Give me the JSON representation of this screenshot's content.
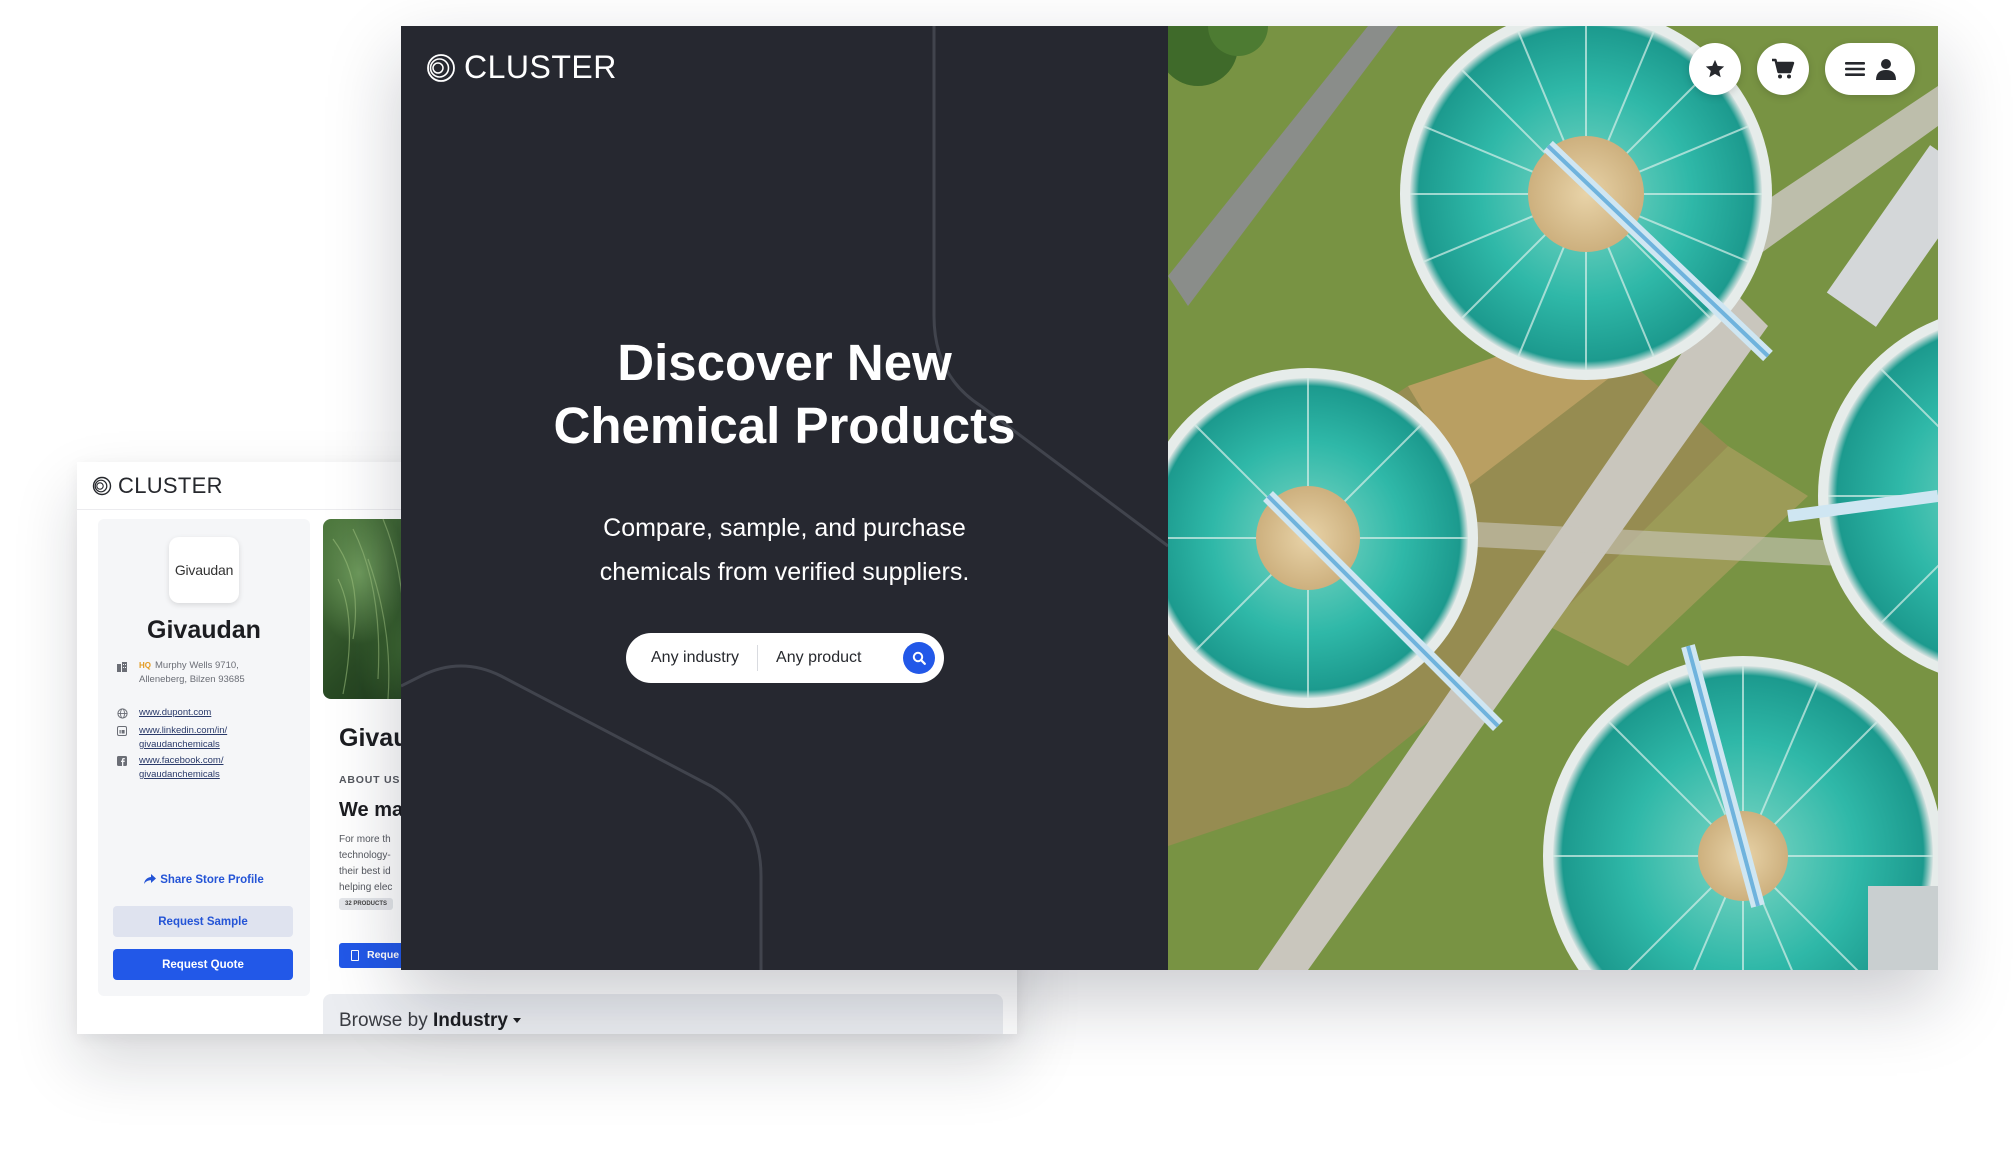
{
  "back_window": {
    "logo_text": "CLUSTER",
    "brand_badge_text": "Givaudan",
    "store_name": "Givaudan",
    "hq_tag": "HQ",
    "address_line1": "Murphy Wells 9710,",
    "address_line2": "Alleneberg, Bilzen 93685",
    "website": "www.dupont.com",
    "linkedin_line1": "www.linkedin.com/in/",
    "linkedin_line2": "givaudanchemicals",
    "facebook_line1": "www.facebook.com/",
    "facebook_line2": "givaudanchemicals",
    "share_label": "Share Store Profile",
    "request_sample_label": "Request Sample",
    "request_quote_label": "Request Quote",
    "store_title_partial": "Givau",
    "about_label": "ABOUT US",
    "about_heading_partial": "We ma",
    "about_body_partial": "For more th\ntechnology-\ntheir best id\nhelping elec",
    "products_pill": "32 PRODUCTS",
    "request_partial": "Reque",
    "browse_prefix": "Browse by",
    "browse_bold": "Industry"
  },
  "front_window": {
    "logo_text": "CLUSTER",
    "hero_title": "Discover New\nChemical Products",
    "hero_subtitle": "Compare, sample, and purchase\nchemicals from verified suppliers.",
    "search": {
      "industry_label": "Any industry",
      "product_label": "Any product"
    },
    "nav_icons": [
      "star-icon",
      "cart-icon",
      "menu-icon",
      "user-icon"
    ]
  },
  "colors": {
    "hero_bg": "#262830",
    "accent_blue": "#2258e8",
    "hq_orange": "#e39a20"
  }
}
